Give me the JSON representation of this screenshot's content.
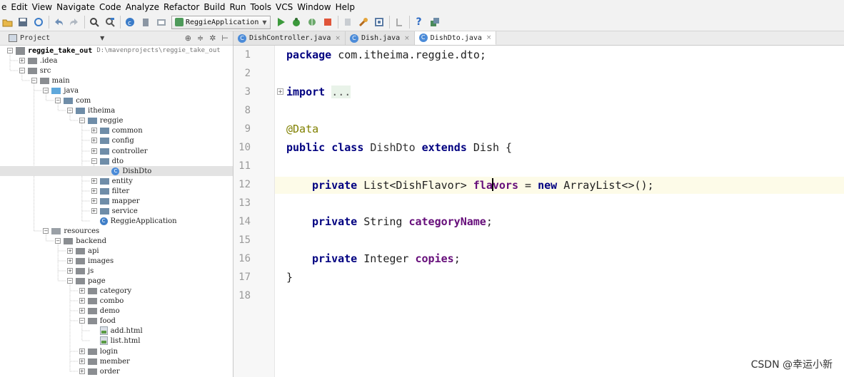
{
  "menubar": {
    "items": [
      "e",
      "Edit",
      "View",
      "Navigate",
      "Code",
      "Analyze",
      "Refactor",
      "Build",
      "Run",
      "Tools",
      "VCS",
      "Window",
      "Help"
    ]
  },
  "toolbar": {
    "run_config_label": "ReggieApplication",
    "icons": [
      "open-folder-icon",
      "save-icon",
      "sync-icon",
      "undo-icon",
      "redo-icon",
      "search-icon",
      "replace-icon",
      "compile-icon",
      "build-icon",
      "project-structure-icon",
      "run-config-icon",
      "run-icon",
      "debug-icon",
      "coverage-icon",
      "stop-icon",
      "terminate-icon",
      "settings-icon",
      "sdk-icon",
      "vcs-icon",
      "help-icon",
      "database-icon"
    ]
  },
  "project_panel": {
    "title": "Project",
    "tree": [
      {
        "label": "reggie_take_out",
        "path": "D:\\mavenprojects\\reggie_take_out",
        "depth": 0,
        "type": "module",
        "toggle": "-",
        "bold": true
      },
      {
        "label": ".idea",
        "depth": 1,
        "type": "folder",
        "toggle": "+"
      },
      {
        "label": "src",
        "depth": 1,
        "type": "folder",
        "toggle": "-"
      },
      {
        "label": "main",
        "depth": 2,
        "type": "folder",
        "toggle": "-"
      },
      {
        "label": "java",
        "depth": 3,
        "type": "source",
        "toggle": "-"
      },
      {
        "label": "com",
        "depth": 4,
        "type": "package",
        "toggle": "-"
      },
      {
        "label": "itheima",
        "depth": 5,
        "type": "package",
        "toggle": "-"
      },
      {
        "label": "reggie",
        "depth": 6,
        "type": "package",
        "toggle": "-"
      },
      {
        "label": "common",
        "depth": 7,
        "type": "package",
        "toggle": "+"
      },
      {
        "label": "config",
        "depth": 7,
        "type": "package",
        "toggle": "+"
      },
      {
        "label": "controller",
        "depth": 7,
        "type": "package",
        "toggle": "+"
      },
      {
        "label": "dto",
        "depth": 7,
        "type": "package",
        "toggle": "-"
      },
      {
        "label": "DishDto",
        "depth": 8,
        "type": "class",
        "toggle": "",
        "selected": true
      },
      {
        "label": "entity",
        "depth": 7,
        "type": "package",
        "toggle": "+"
      },
      {
        "label": "filter",
        "depth": 7,
        "type": "package",
        "toggle": "+"
      },
      {
        "label": "mapper",
        "depth": 7,
        "type": "package",
        "toggle": "+"
      },
      {
        "label": "service",
        "depth": 7,
        "type": "package",
        "toggle": "+"
      },
      {
        "label": "ReggieApplication",
        "depth": 7,
        "type": "app",
        "toggle": ""
      },
      {
        "label": "resources",
        "depth": 3,
        "type": "resources",
        "toggle": "-"
      },
      {
        "label": "backend",
        "depth": 4,
        "type": "folder",
        "toggle": "-"
      },
      {
        "label": "api",
        "depth": 5,
        "type": "folder",
        "toggle": "+"
      },
      {
        "label": "images",
        "depth": 5,
        "type": "folder",
        "toggle": "+"
      },
      {
        "label": "js",
        "depth": 5,
        "type": "folder",
        "toggle": "+"
      },
      {
        "label": "page",
        "depth": 5,
        "type": "folder",
        "toggle": "-"
      },
      {
        "label": "category",
        "depth": 6,
        "type": "folder",
        "toggle": "+"
      },
      {
        "label": "combo",
        "depth": 6,
        "type": "folder",
        "toggle": "+"
      },
      {
        "label": "demo",
        "depth": 6,
        "type": "folder",
        "toggle": "+"
      },
      {
        "label": "food",
        "depth": 6,
        "type": "folder",
        "toggle": "-"
      },
      {
        "label": "add.html",
        "depth": 7,
        "type": "file",
        "toggle": ""
      },
      {
        "label": "list.html",
        "depth": 7,
        "type": "file",
        "toggle": ""
      },
      {
        "label": "login",
        "depth": 6,
        "type": "folder",
        "toggle": "+"
      },
      {
        "label": "member",
        "depth": 6,
        "type": "folder",
        "toggle": "+"
      },
      {
        "label": "order",
        "depth": 6,
        "type": "folder",
        "toggle": "+"
      }
    ]
  },
  "editor": {
    "tabs": [
      {
        "label": "DishController.java",
        "active": false
      },
      {
        "label": "Dish.java",
        "active": false
      },
      {
        "label": "DishDto.java",
        "active": true
      }
    ],
    "tab_close_glyph": "×",
    "line_numbers": [
      "1",
      "2",
      "3",
      "8",
      "9",
      "10",
      "11",
      "12",
      "13",
      "14",
      "15",
      "16",
      "17",
      "18"
    ],
    "code": {
      "l1_kw": "package",
      "l1_rest": " com.itheima.reggie.dto;",
      "l3_kw": "import",
      "l3_fold": "...",
      "l9_ann": "@Data",
      "l10_kw1": "public class",
      "l10_name": " DishDto ",
      "l10_kw2": "extends",
      "l10_rest": " Dish {",
      "l12_kw": "private",
      "l12_type": " List<DishFlavor> ",
      "l12_field_a": "fla",
      "l12_field_b": "vors",
      "l12_mid": " = ",
      "l12_kw2": "new",
      "l12_rest": " ArrayList<>();",
      "l14_kw": "private",
      "l14_type": " String ",
      "l14_field": "categoryName",
      "l14_end": ";",
      "l16_kw": "private",
      "l16_type": " Integer ",
      "l16_field": "copies",
      "l16_end": ";",
      "l17": "}"
    }
  },
  "watermark": "CSDN @幸运小新",
  "colors": {
    "keyword": "#000080",
    "annotation": "#808000",
    "field": "#660e7a",
    "current_line": "#fdfbe8",
    "selection": "#e3e3e3"
  }
}
